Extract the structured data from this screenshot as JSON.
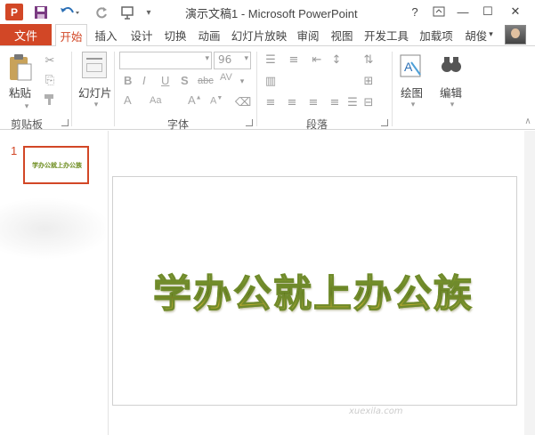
{
  "titlebar": {
    "app_icon": "P",
    "title": "演示文稿1 - Microsoft PowerPoint",
    "qat_icons": [
      "save-icon",
      "undo-icon",
      "redo-icon",
      "start-from-beginning-icon",
      "customize-qat-icon"
    ],
    "help": "?",
    "minimize": "—",
    "restore": "☐",
    "close": "✕"
  },
  "tabs": {
    "file": "文件",
    "items": [
      "开始",
      "插入",
      "设计",
      "切换",
      "动画",
      "幻灯片放映",
      "审阅",
      "视图",
      "开发工具",
      "加载项"
    ],
    "user": "胡俊"
  },
  "ribbon": {
    "clipboard": {
      "paste": "粘贴",
      "label": "剪贴板"
    },
    "slides": {
      "new_slide": "幻灯片",
      "label": "幻灯片"
    },
    "font": {
      "size": "96",
      "label": "字体"
    },
    "paragraph": {
      "label": "段落"
    },
    "drawing": {
      "label": "绘图"
    },
    "editing": {
      "label": "编辑"
    }
  },
  "editor": {
    "slide_number": "1",
    "thumb_title": "学办公就上办公族",
    "slide_title": "学办公就上办公族"
  },
  "watermark": "xuexila.com"
}
